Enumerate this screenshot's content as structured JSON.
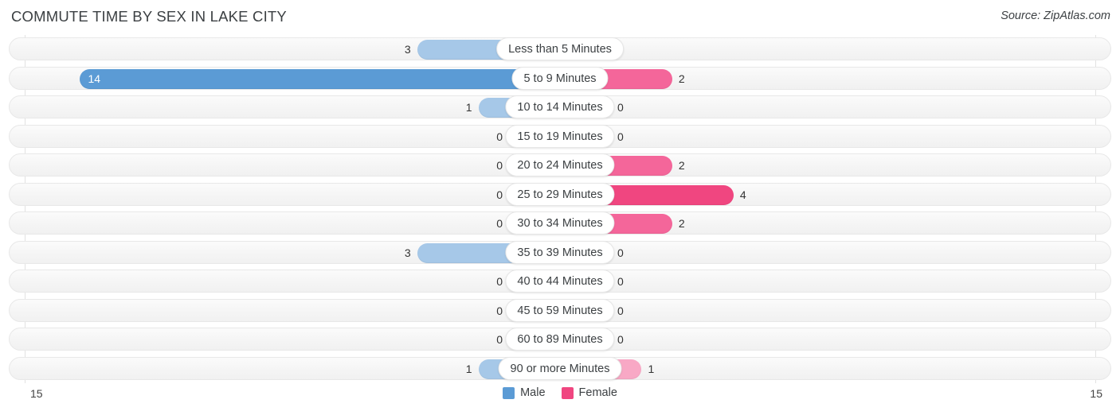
{
  "header": {
    "title": "COMMUTE TIME BY SEX IN LAKE CITY",
    "source": "Source: ZipAtlas.com"
  },
  "axis": {
    "min_label": "15",
    "max_label": "15",
    "scale_max": 15
  },
  "legend": {
    "items": [
      {
        "label": "Male",
        "color": "#5b9bd5",
        "name": "legend-male"
      },
      {
        "label": "Female",
        "color": "#f04680",
        "name": "legend-female"
      }
    ]
  },
  "colors": {
    "male_light": "#a6c8e8",
    "male_strong": "#5b9bd5",
    "female_light": "#f8a8c5",
    "female_mid": "#f4669a",
    "female_strong": "#f04680",
    "track": "#f4f4f4",
    "gridline": "#e2e2e2",
    "text": "#3c4043"
  },
  "chart_data": {
    "type": "bar",
    "title": "COMMUTE TIME BY SEX IN LAKE CITY",
    "subtitle": "",
    "xlabel": "",
    "ylabel": "",
    "orientation": "horizontal-diverging",
    "grid": true,
    "legend_position": "bottom-center",
    "xlim": [
      15,
      15
    ],
    "categories": [
      "Less than 5 Minutes",
      "5 to 9 Minutes",
      "10 to 14 Minutes",
      "15 to 19 Minutes",
      "20 to 24 Minutes",
      "25 to 29 Minutes",
      "30 to 34 Minutes",
      "35 to 39 Minutes",
      "40 to 44 Minutes",
      "45 to 59 Minutes",
      "60 to 89 Minutes",
      "90 or more Minutes"
    ],
    "series": [
      {
        "name": "Male",
        "values": [
          3,
          14,
          1,
          0,
          0,
          0,
          0,
          3,
          0,
          0,
          0,
          1
        ]
      },
      {
        "name": "Female",
        "values": [
          0,
          2,
          0,
          0,
          2,
          4,
          2,
          0,
          0,
          0,
          0,
          1
        ]
      }
    ]
  },
  "rows": [
    {
      "label": "Less than 5 Minutes",
      "male": "3",
      "female": "0"
    },
    {
      "label": "5 to 9 Minutes",
      "male": "14",
      "female": "2"
    },
    {
      "label": "10 to 14 Minutes",
      "male": "1",
      "female": "0"
    },
    {
      "label": "15 to 19 Minutes",
      "male": "0",
      "female": "0"
    },
    {
      "label": "20 to 24 Minutes",
      "male": "0",
      "female": "2"
    },
    {
      "label": "25 to 29 Minutes",
      "male": "0",
      "female": "4"
    },
    {
      "label": "30 to 34 Minutes",
      "male": "0",
      "female": "2"
    },
    {
      "label": "35 to 39 Minutes",
      "male": "3",
      "female": "0"
    },
    {
      "label": "40 to 44 Minutes",
      "male": "0",
      "female": "0"
    },
    {
      "label": "45 to 59 Minutes",
      "male": "0",
      "female": "0"
    },
    {
      "label": "60 to 89 Minutes",
      "male": "0",
      "female": "0"
    },
    {
      "label": "90 or more Minutes",
      "male": "1",
      "female": "1"
    }
  ]
}
